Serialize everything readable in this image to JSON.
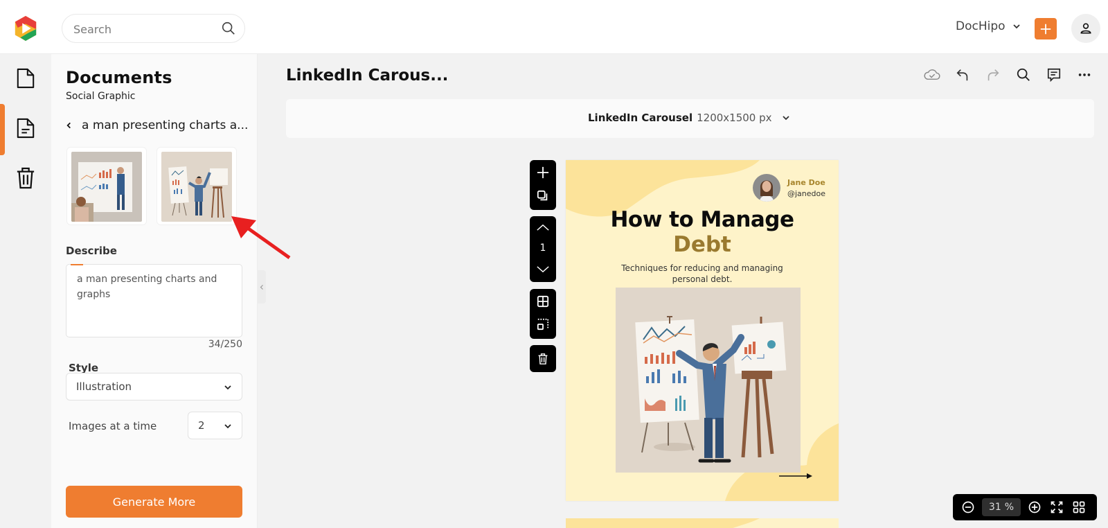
{
  "header": {
    "search_placeholder": "Search",
    "brand_menu_label": "DocHipo",
    "accent_color": "#ef7d30"
  },
  "rail": {
    "items": [
      {
        "name": "documents",
        "icon": "file-icon",
        "active": false
      },
      {
        "name": "templates",
        "icon": "file-text-icon",
        "active": true
      },
      {
        "name": "trash",
        "icon": "trash-icon",
        "active": false
      }
    ]
  },
  "panel": {
    "title": "Documents",
    "subtitle": "Social Graphic",
    "back_label": "a man presenting charts a...",
    "generated_images": [
      {
        "description": "man presenting charts on whiteboard to seated woman"
      },
      {
        "description": "illustrated man presenting charts on easels"
      }
    ],
    "describe_label": "Describe",
    "describe_value": "a man presenting charts and graphs",
    "char_counter": "34/250",
    "style_label": "Style",
    "style_value": "Illustration",
    "images_label": "Images at a time",
    "images_value": "2",
    "generate_button": "Generate More"
  },
  "workspace": {
    "doc_title": "LinkedIn Carous...",
    "toolbar": [
      "cloud-saved-icon",
      "undo-icon",
      "redo-icon",
      "search-icon",
      "comment-icon",
      "more-icon"
    ],
    "size_name": "LinkedIn Carousel",
    "size_dims": "1200x1500 px",
    "page_number": "1",
    "zoom_value": "31",
    "zoom_unit": "%"
  },
  "canvas": {
    "author_name": "Jane Doe",
    "author_handle": "@janedoe",
    "headline_line1": "How to Manage",
    "headline_line2": "Debt",
    "tagline": "Techniques for reducing and managing personal debt.",
    "bg_color": "#fef3c9",
    "blob_color": "#fce39a",
    "highlight_color": "#9a7a2f"
  }
}
